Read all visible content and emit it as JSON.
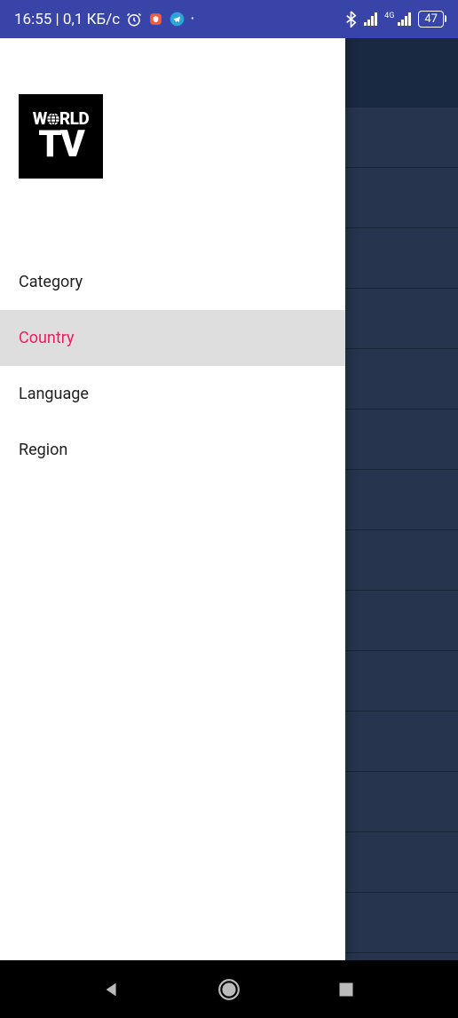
{
  "status_bar": {
    "time_data": "16:55 | 0,1 КБ/с",
    "network_type": "4G",
    "battery_level": "47"
  },
  "logo": {
    "line1_prefix": "W",
    "line1_suffix": "RLD",
    "line2": "TV"
  },
  "drawer": {
    "items": [
      {
        "label": "Category",
        "active": false
      },
      {
        "label": "Country",
        "active": true
      },
      {
        "label": "Language",
        "active": false
      },
      {
        "label": "Region",
        "active": false
      }
    ]
  }
}
